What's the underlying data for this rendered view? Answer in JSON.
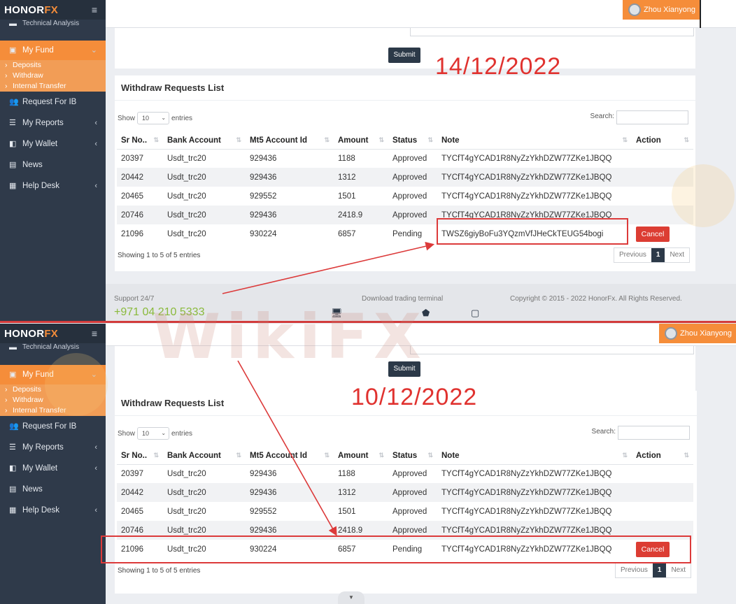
{
  "brand": {
    "name": "HONOR",
    "fx": "FX"
  },
  "user": {
    "name": "Zhou Xianyong"
  },
  "sidebar": {
    "cut_item": "Technical Analysis",
    "my_fund": "My Fund",
    "sub_items": [
      "Deposits",
      "Withdraw",
      "Internal Transfer"
    ],
    "items": [
      "Request For IB",
      "My Reports",
      "My Wallet",
      "News",
      "Help Desk"
    ]
  },
  "form": {
    "submit_label": "Submit"
  },
  "list": {
    "title": "Withdraw Requests List",
    "show_label": "Show",
    "show_value": "10",
    "entries_label": "entries",
    "search_label": "Search:",
    "headers": [
      "Sr No..",
      "Bank Account",
      "Mt5 Account Id",
      "Amount",
      "Status",
      "Note",
      "Action"
    ],
    "rows_top": [
      [
        "20397",
        "Usdt_trc20",
        "929436",
        "1188",
        "Approved",
        "TYCfT4gYCAD1R8NyZzYkhDZW77ZKe1JBQQ"
      ],
      [
        "20442",
        "Usdt_trc20",
        "929436",
        "1312",
        "Approved",
        "TYCfT4gYCAD1R8NyZzYkhDZW77ZKe1JBQQ"
      ],
      [
        "20465",
        "Usdt_trc20",
        "929552",
        "1501",
        "Approved",
        "TYCfT4gYCAD1R8NyZzYkhDZW77ZKe1JBQQ"
      ],
      [
        "20746",
        "Usdt_trc20",
        "929436",
        "2418.9",
        "Approved",
        "TYCfT4gYCAD1R8NyZzYkhDZW77ZKe1JBQQ"
      ],
      [
        "21096",
        "Usdt_trc20",
        "930224",
        "6857",
        "Pending",
        "TWSZ6giyBoFu3YQzmVfJHeCkTEUG54bogi"
      ]
    ],
    "rows_bottom": [
      [
        "20397",
        "Usdt_trc20",
        "929436",
        "1188",
        "Approved",
        "TYCfT4gYCAD1R8NyZzYkhDZW77ZKe1JBQQ"
      ],
      [
        "20442",
        "Usdt_trc20",
        "929436",
        "1312",
        "Approved",
        "TYCfT4gYCAD1R8NyZzYkhDZW77ZKe1JBQQ"
      ],
      [
        "20465",
        "Usdt_trc20",
        "929552",
        "1501",
        "Approved",
        "TYCfT4gYCAD1R8NyZzYkhDZW77ZKe1JBQQ"
      ],
      [
        "20746",
        "Usdt_trc20",
        "929436",
        "2418.9",
        "Approved",
        "TYCfT4gYCAD1R8NyZzYkhDZW77ZKe1JBQQ"
      ],
      [
        "21096",
        "Usdt_trc20",
        "930224",
        "6857",
        "Pending",
        "TYCfT4gYCAD1R8NyZzYkhDZW77ZKe1JBQQ"
      ]
    ],
    "cancel_label": "Cancel",
    "showing": "Showing 1 to 5 of 5 entries",
    "pager": {
      "prev": "Previous",
      "page": "1",
      "next": "Next"
    }
  },
  "footer": {
    "support": "Support 24/7",
    "phone": "+971 04 210 5333",
    "download": "Download trading terminal",
    "copyright": "Copyright © 2015 - 2022 HonorFx. All Rights Reserved."
  },
  "annotations": {
    "top_date": "14/12/2022",
    "bottom_date": "10/12/2022",
    "watermark": "WikiFX",
    "highlight_color": "#dc3a3a"
  },
  "colors": {
    "accent": "#f58d3a",
    "sidebar": "#2f3a4a",
    "cancel": "#dc3d33",
    "phone": "#8aba3c"
  }
}
